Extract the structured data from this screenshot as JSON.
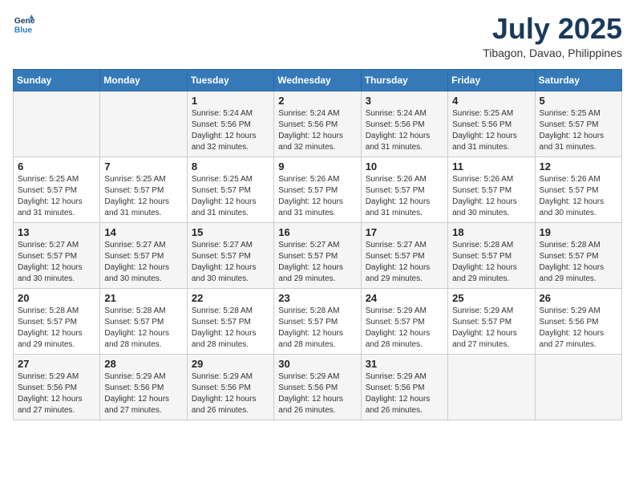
{
  "header": {
    "logo_line1": "General",
    "logo_line2": "Blue",
    "month": "July 2025",
    "location": "Tibagon, Davao, Philippines"
  },
  "weekdays": [
    "Sunday",
    "Monday",
    "Tuesday",
    "Wednesday",
    "Thursday",
    "Friday",
    "Saturday"
  ],
  "weeks": [
    [
      {
        "day": "",
        "info": ""
      },
      {
        "day": "",
        "info": ""
      },
      {
        "day": "1",
        "info": "Sunrise: 5:24 AM\nSunset: 5:56 PM\nDaylight: 12 hours\nand 32 minutes."
      },
      {
        "day": "2",
        "info": "Sunrise: 5:24 AM\nSunset: 5:56 PM\nDaylight: 12 hours\nand 32 minutes."
      },
      {
        "day": "3",
        "info": "Sunrise: 5:24 AM\nSunset: 5:56 PM\nDaylight: 12 hours\nand 31 minutes."
      },
      {
        "day": "4",
        "info": "Sunrise: 5:25 AM\nSunset: 5:56 PM\nDaylight: 12 hours\nand 31 minutes."
      },
      {
        "day": "5",
        "info": "Sunrise: 5:25 AM\nSunset: 5:57 PM\nDaylight: 12 hours\nand 31 minutes."
      }
    ],
    [
      {
        "day": "6",
        "info": "Sunrise: 5:25 AM\nSunset: 5:57 PM\nDaylight: 12 hours\nand 31 minutes."
      },
      {
        "day": "7",
        "info": "Sunrise: 5:25 AM\nSunset: 5:57 PM\nDaylight: 12 hours\nand 31 minutes."
      },
      {
        "day": "8",
        "info": "Sunrise: 5:25 AM\nSunset: 5:57 PM\nDaylight: 12 hours\nand 31 minutes."
      },
      {
        "day": "9",
        "info": "Sunrise: 5:26 AM\nSunset: 5:57 PM\nDaylight: 12 hours\nand 31 minutes."
      },
      {
        "day": "10",
        "info": "Sunrise: 5:26 AM\nSunset: 5:57 PM\nDaylight: 12 hours\nand 31 minutes."
      },
      {
        "day": "11",
        "info": "Sunrise: 5:26 AM\nSunset: 5:57 PM\nDaylight: 12 hours\nand 30 minutes."
      },
      {
        "day": "12",
        "info": "Sunrise: 5:26 AM\nSunset: 5:57 PM\nDaylight: 12 hours\nand 30 minutes."
      }
    ],
    [
      {
        "day": "13",
        "info": "Sunrise: 5:27 AM\nSunset: 5:57 PM\nDaylight: 12 hours\nand 30 minutes."
      },
      {
        "day": "14",
        "info": "Sunrise: 5:27 AM\nSunset: 5:57 PM\nDaylight: 12 hours\nand 30 minutes."
      },
      {
        "day": "15",
        "info": "Sunrise: 5:27 AM\nSunset: 5:57 PM\nDaylight: 12 hours\nand 30 minutes."
      },
      {
        "day": "16",
        "info": "Sunrise: 5:27 AM\nSunset: 5:57 PM\nDaylight: 12 hours\nand 29 minutes."
      },
      {
        "day": "17",
        "info": "Sunrise: 5:27 AM\nSunset: 5:57 PM\nDaylight: 12 hours\nand 29 minutes."
      },
      {
        "day": "18",
        "info": "Sunrise: 5:28 AM\nSunset: 5:57 PM\nDaylight: 12 hours\nand 29 minutes."
      },
      {
        "day": "19",
        "info": "Sunrise: 5:28 AM\nSunset: 5:57 PM\nDaylight: 12 hours\nand 29 minutes."
      }
    ],
    [
      {
        "day": "20",
        "info": "Sunrise: 5:28 AM\nSunset: 5:57 PM\nDaylight: 12 hours\nand 29 minutes."
      },
      {
        "day": "21",
        "info": "Sunrise: 5:28 AM\nSunset: 5:57 PM\nDaylight: 12 hours\nand 28 minutes."
      },
      {
        "day": "22",
        "info": "Sunrise: 5:28 AM\nSunset: 5:57 PM\nDaylight: 12 hours\nand 28 minutes."
      },
      {
        "day": "23",
        "info": "Sunrise: 5:28 AM\nSunset: 5:57 PM\nDaylight: 12 hours\nand 28 minutes."
      },
      {
        "day": "24",
        "info": "Sunrise: 5:29 AM\nSunset: 5:57 PM\nDaylight: 12 hours\nand 28 minutes."
      },
      {
        "day": "25",
        "info": "Sunrise: 5:29 AM\nSunset: 5:57 PM\nDaylight: 12 hours\nand 27 minutes."
      },
      {
        "day": "26",
        "info": "Sunrise: 5:29 AM\nSunset: 5:56 PM\nDaylight: 12 hours\nand 27 minutes."
      }
    ],
    [
      {
        "day": "27",
        "info": "Sunrise: 5:29 AM\nSunset: 5:56 PM\nDaylight: 12 hours\nand 27 minutes."
      },
      {
        "day": "28",
        "info": "Sunrise: 5:29 AM\nSunset: 5:56 PM\nDaylight: 12 hours\nand 27 minutes."
      },
      {
        "day": "29",
        "info": "Sunrise: 5:29 AM\nSunset: 5:56 PM\nDaylight: 12 hours\nand 26 minutes."
      },
      {
        "day": "30",
        "info": "Sunrise: 5:29 AM\nSunset: 5:56 PM\nDaylight: 12 hours\nand 26 minutes."
      },
      {
        "day": "31",
        "info": "Sunrise: 5:29 AM\nSunset: 5:56 PM\nDaylight: 12 hours\nand 26 minutes."
      },
      {
        "day": "",
        "info": ""
      },
      {
        "day": "",
        "info": ""
      }
    ]
  ]
}
